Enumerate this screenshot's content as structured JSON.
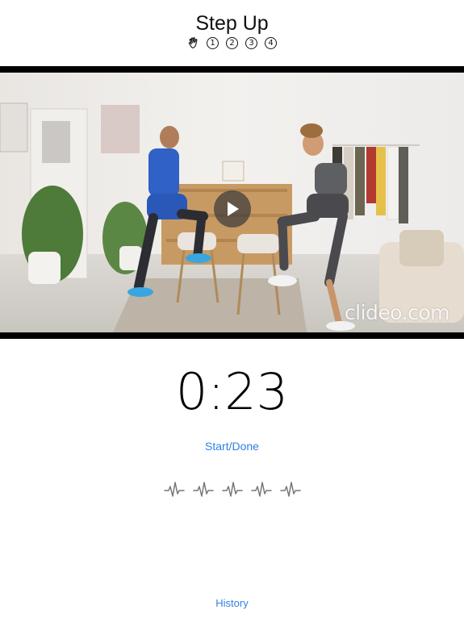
{
  "header": {
    "title": "Step Up",
    "steps": [
      {
        "icon": "hand-wave-icon"
      },
      {
        "label": "1"
      },
      {
        "label": "2"
      },
      {
        "label": "3"
      },
      {
        "label": "4"
      }
    ]
  },
  "video": {
    "watermark": "clideo.com",
    "play_icon": "play-icon"
  },
  "timer": {
    "value": "0:23"
  },
  "actions": {
    "start_done_label": "Start/Done",
    "history_label": "History"
  },
  "heart_rate": {
    "icon": "heartbeat-icon",
    "count": 5
  },
  "colors": {
    "accent": "#2f7fe6",
    "video_frame": "#000000"
  }
}
